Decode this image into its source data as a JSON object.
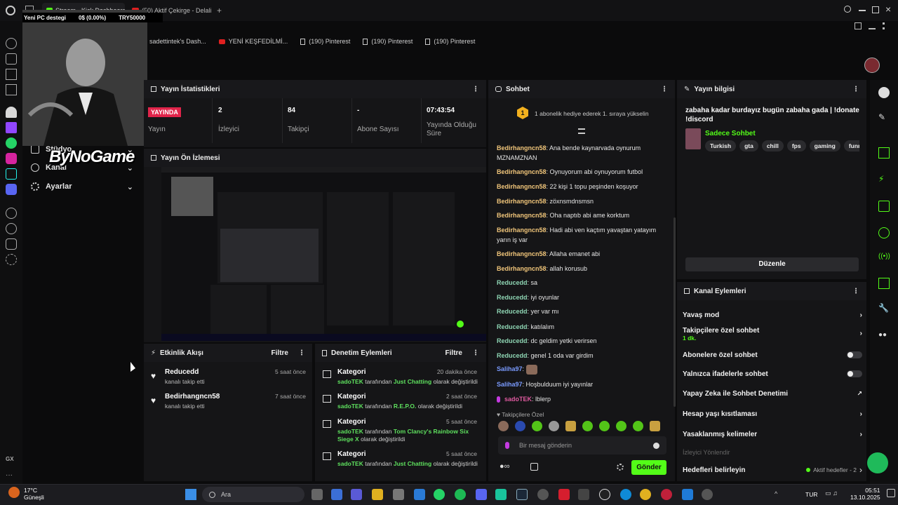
{
  "browser": {
    "tabs": [
      {
        "label": "Stream - Kick Dashboard"
      },
      {
        "label": "(50) Aktif Çekirge - Delali..."
      }
    ],
    "bookmarks": [
      "sadettintek's Dash...",
      "YENİ KEŞFEDİLMİ...",
      "(190) Pinterest",
      "(190) Pinterest",
      "(190) Pinterest"
    ]
  },
  "overlay": {
    "goal_label": "Yeni PC destegi",
    "goal_progress": "0$ (0.00%)",
    "goal_target": "TRY50000",
    "logo": "ByNoGame"
  },
  "nav": {
    "items": [
      {
        "label": "Stüdyo",
        "icon": "studio-icon"
      },
      {
        "label": "Kanal",
        "icon": "channel-icon"
      },
      {
        "label": "Ayarlar",
        "icon": "gear-icon"
      }
    ]
  },
  "stats": {
    "title": "Yayın İstatistikleri",
    "live_badge": "YAYINDA",
    "items": [
      {
        "value": "",
        "label": "Yayın"
      },
      {
        "value": "2",
        "label": "İzleyici"
      },
      {
        "value": "84",
        "label": "Takipçi"
      },
      {
        "value": "-",
        "label": "Abone Sayısı"
      },
      {
        "value": "07:43:54",
        "label": "Yayında Olduğu Süre"
      }
    ]
  },
  "preview": {
    "title": "Yayın Ön İzlemesi"
  },
  "activity": {
    "title": "Etkinlik Akışı",
    "filter": "Filtre",
    "items": [
      {
        "name": "Reducedd",
        "sub": "kanalı takip etti",
        "time": "5 saat önce"
      },
      {
        "name": "Bedirhangncn58",
        "sub": "kanalı takip etti",
        "time": "7 saat önce"
      }
    ]
  },
  "moderation": {
    "title": "Denetim Eylemleri",
    "filter": "Filtre",
    "items": [
      {
        "title": "Kategori",
        "time": "20 dakika önce",
        "user": "sadoTEK",
        "mid": "tarafından",
        "cat": "Just Chatting",
        "tail": "olarak değiştirildi"
      },
      {
        "title": "Kategori",
        "time": "2 saat önce",
        "user": "sadoTEK",
        "mid": "tarafından",
        "cat": "R.E.P.O.",
        "tail": "olarak değiştirildi"
      },
      {
        "title": "Kategori",
        "time": "5 saat önce",
        "user": "sadoTEK",
        "mid": "tarafından",
        "cat": "Tom Clancy's Rainbow Six Siege X",
        "tail": "olarak değiştirildi"
      },
      {
        "title": "Kategori",
        "time": "5 saat önce",
        "user": "sadoTEK",
        "mid": "tarafından",
        "cat": "Just Chatting",
        "tail": "olarak değiştirildi"
      }
    ]
  },
  "chat": {
    "title": "Sohbet",
    "notice": "1 abonelik hediye ederek 1. sıraya yükselin",
    "notice_badge": "1",
    "messages": [
      {
        "user": "Bedirhangncn58",
        "text": "Ana bende kaynarvada oynurum MZNAMZNAN",
        "cls": "u-bed"
      },
      {
        "user": "Bedirhangncn58",
        "text": "Oynuyorum abi oynuyorum futbol",
        "cls": "u-bed"
      },
      {
        "user": "Bedirhangncn58",
        "text": "22 kişi 1 topu peşinden koşuyor",
        "cls": "u-bed"
      },
      {
        "user": "Bedirhangncn58",
        "text": "zöxnsmdnsmsn",
        "cls": "u-bed"
      },
      {
        "user": "Bedirhangncn58",
        "text": "Oha naptıb abi ame korktum",
        "cls": "u-bed"
      },
      {
        "user": "Bedirhangncn58",
        "text": "Hadi abi ven kaçtım yavaştan yatayım yarın iş var",
        "cls": "u-bed"
      },
      {
        "user": "Bedirhangncn58",
        "text": "Allaha emanet abi",
        "cls": "u-bed"
      },
      {
        "user": "Bedirhangncn58",
        "text": "allah korusub",
        "cls": "u-bed"
      },
      {
        "user": "Reducedd",
        "text": "sa",
        "cls": "u-red"
      },
      {
        "user": "Reducedd",
        "text": "iyi oyunlar",
        "cls": "u-red"
      },
      {
        "user": "Reducedd",
        "text": "yer var mı",
        "cls": "u-red"
      },
      {
        "user": "Reducedd",
        "text": "katılalım",
        "cls": "u-red"
      },
      {
        "user": "Reducedd",
        "text": "dc geldim yetki verirsen",
        "cls": "u-red"
      },
      {
        "user": "Reducedd",
        "text": "genel 1 oda var girdim",
        "cls": "u-red"
      },
      {
        "user": "Saliha97",
        "text": "",
        "cls": "u-sal"
      },
      {
        "user": "Saliha97",
        "text": "Hoşbulduum iyi yayınlar",
        "cls": "u-sal"
      },
      {
        "user": "sadoTEK",
        "text": "lblerp",
        "cls": "u-sado"
      }
    ],
    "followers_only": "Takipçilere Özel",
    "input_placeholder": "Bir mesaj gönderin",
    "send": "Gönder"
  },
  "stream_info": {
    "title": "Yayın bilgisi",
    "stream_title": "zabaha kadar burdayız bugün zabaha gada | !donate !discord",
    "category": "Sadece Sohbet",
    "tags": [
      "Turkish",
      "gta",
      "chill",
      "fps",
      "gaming",
      "funny"
    ],
    "edit": "Düzenle"
  },
  "channel_actions": {
    "title": "Kanal Eylemleri",
    "items": [
      {
        "label": "Yavaş mod",
        "extra": ""
      },
      {
        "label": "Takipçilere özel sohbet",
        "extra": "1 dk."
      },
      {
        "label": "Abonelere özel sohbet",
        "extra": ""
      },
      {
        "label": "Yalnızca ifadelerle sohbet",
        "extra": ""
      },
      {
        "label": "Yapay Zeka ile Sohbet Denetimi",
        "extra": ""
      },
      {
        "label": "Hesap yaşı kısıtlaması",
        "extra": ""
      },
      {
        "label": "Yasaklanmış kelimeler",
        "extra": ""
      }
    ],
    "section": "İzleyici Yönlendir",
    "goal_label": "Hedefleri belirleyin",
    "goal_status": "Aktif hedefler - 2"
  },
  "taskbar": {
    "weather_temp": "17°C",
    "weather_desc": "Güneşli",
    "search": "Ara",
    "lang": "TUR",
    "time": "05:51",
    "date": "13.10.2025"
  },
  "colors": {
    "accent": "#53fc18",
    "live": "#e0244a"
  }
}
